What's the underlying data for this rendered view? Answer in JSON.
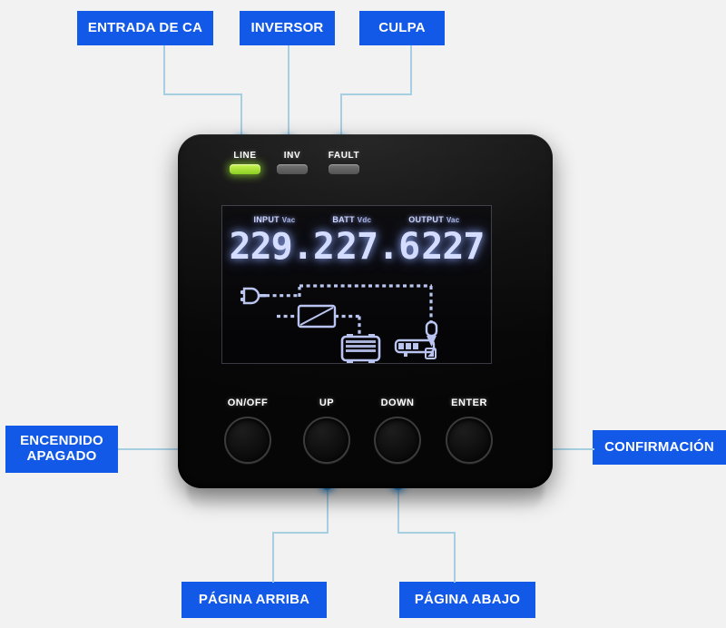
{
  "page": {
    "background_color": "#f2f2f2",
    "accent_color": "#1259e8",
    "connector_color": "#a7cfe2",
    "dot_color": "#1f8fe8"
  },
  "callouts": [
    {
      "id": "ac-input",
      "lines": [
        "ENTRADA DE CA"
      ]
    },
    {
      "id": "inverter",
      "lines": [
        "INVERSOR"
      ]
    },
    {
      "id": "fault",
      "lines": [
        "CULPA"
      ]
    },
    {
      "id": "power-onoff",
      "lines": [
        "ENCENDIDO",
        "APAGADO"
      ]
    },
    {
      "id": "confirm",
      "lines": [
        "CONFIRMACIÓN"
      ]
    },
    {
      "id": "page-up",
      "lines": [
        "PÁGINA ARRIBA"
      ]
    },
    {
      "id": "page-down",
      "lines": [
        "PÁGINA ABAJO"
      ]
    }
  ],
  "device": {
    "leds": [
      {
        "label": "LINE",
        "state": "on",
        "color": "#93e226"
      },
      {
        "label": "INV",
        "state": "off",
        "color": "#5a5a5a"
      },
      {
        "label": "FAULT",
        "state": "off",
        "color": "#5a5a5a"
      }
    ],
    "lcd": {
      "readings": [
        {
          "label": "INPUT",
          "unit": "Vac",
          "value": "229.2"
        },
        {
          "label": "BATT",
          "unit": "Vdc",
          "value": "27.6"
        },
        {
          "label": "OUTPUT",
          "unit": "Vac",
          "value": "227"
        }
      ],
      "digits_text": "229.2 27.6 227",
      "schematic_icons": [
        "plug-icon",
        "inverter-icon",
        "battery-icon",
        "load-bar-icon",
        "lamp-icon",
        "alarm-mute-icon"
      ]
    },
    "buttons": [
      {
        "label": "ON/OFF"
      },
      {
        "label": "UP"
      },
      {
        "label": "DOWN"
      },
      {
        "label": "ENTER"
      }
    ]
  }
}
